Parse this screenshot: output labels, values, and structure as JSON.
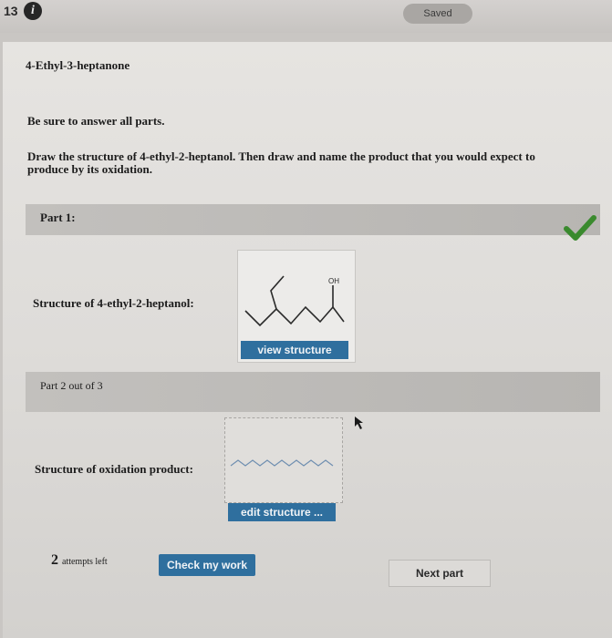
{
  "header": {
    "question_number": "13",
    "info_glyph": "i",
    "saved_label": "Saved"
  },
  "question": {
    "title": "4-Ethyl-3-heptanone",
    "instruction": "Be sure to answer all parts.",
    "prompt_line1": "Draw the structure of 4-ethyl-2-heptanol. Then draw and name the product that you would expect to",
    "prompt_line2": "produce by its oxidation."
  },
  "part1": {
    "header": "Part 1:",
    "status_icon": "check-icon",
    "status_color": "#3a8a2e",
    "structure_label": "Structure of 4-ethyl-2-heptanol:",
    "oh_label": "OH",
    "view_button": "view structure"
  },
  "part2": {
    "header": "Part 2 out of 3",
    "structure_label": "Structure of oxidation product:",
    "edit_button": "edit structure ..."
  },
  "footer": {
    "attempts_count": "2",
    "attempts_text": "attempts left",
    "check_button": "Check my work",
    "next_button": "Next part"
  },
  "colors": {
    "accent_blue": "#2f6f9e"
  }
}
